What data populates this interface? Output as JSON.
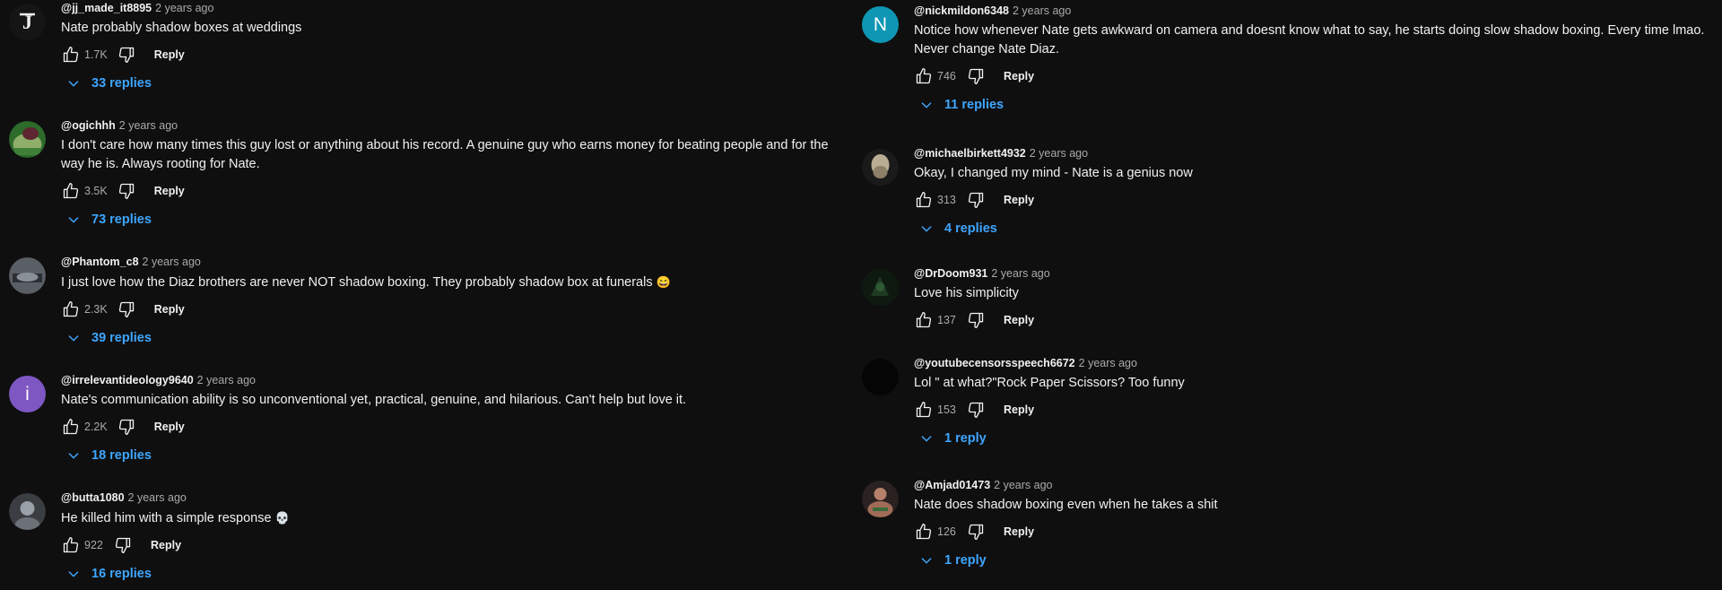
{
  "left": {
    "comments": [
      {
        "author": "@jj_made_it8895",
        "time": "2 years ago",
        "text": "Nate probably shadow boxes at weddings",
        "likes": "1.7K",
        "reply_label": "Reply",
        "replies": "33 replies"
      },
      {
        "author": "@ogichhh",
        "time": "2 years ago",
        "text": "I don't care how many times this guy lost or anything about his record. A genuine guy who earns money for beating people and for the way he is. Always rooting for Nate.",
        "likes": "3.5K",
        "reply_label": "Reply",
        "replies": "73 replies"
      },
      {
        "author": "@Phantom_c8",
        "time": "2 years ago",
        "text": "I just love how the Diaz brothers are never NOT shadow boxing. They probably shadow box at funerals",
        "emoji": "😄",
        "likes": "2.3K",
        "reply_label": "Reply",
        "replies": "39 replies"
      },
      {
        "author": "@irrelevantideology9640",
        "time": "2 years ago",
        "text": "Nate's communication ability is so unconventional yet, practical, genuine, and hilarious. Can't help but love it.",
        "likes": "2.2K",
        "reply_label": "Reply",
        "replies": "18 replies",
        "avatar_letter": "i",
        "avatar_color": "#7e57c2"
      },
      {
        "author": "@butta1080",
        "time": "2 years ago",
        "text": "He killed him with a simple response",
        "emoji": "💀",
        "likes": "922",
        "reply_label": "Reply",
        "replies": "16 replies"
      }
    ]
  },
  "right": {
    "comments": [
      {
        "author": "@nickmildon6348",
        "time": "2 years ago",
        "text": "Notice how whenever Nate gets awkward on camera and doesnt know what to say, he starts doing slow shadow boxing. Every time lmao. Never change Nate Diaz.",
        "likes": "746",
        "reply_label": "Reply",
        "replies": "11 replies",
        "avatar_letter": "N",
        "avatar_color": "#0f96b4"
      },
      {
        "author": "@michaelbirkett4932",
        "time": "2 years ago",
        "text": "Okay, I changed my mind - Nate is a genius now",
        "likes": "313",
        "reply_label": "Reply",
        "replies": "4 replies"
      },
      {
        "author": "@DrDoom931",
        "time": "2 years ago",
        "text": "Love his simplicity",
        "likes": "137",
        "reply_label": "Reply"
      },
      {
        "author": "@youtubecensorsspeech6672",
        "time": "2 years ago",
        "text": "Lol \" at what?\"Rock Paper Scissors? Too funny",
        "likes": "153",
        "reply_label": "Reply",
        "replies": "1 reply"
      },
      {
        "author": "@Amjad01473",
        "time": "2 years ago",
        "text": "Nate does shadow boxing even when he takes a shit",
        "likes": "126",
        "reply_label": "Reply",
        "replies": "1 reply"
      }
    ]
  },
  "colors": {
    "background": "#0f0f0f",
    "link": "#3ea6ff",
    "muted": "#aaaaaa",
    "text": "#f1f1f1"
  },
  "icons": [
    "thumb-up-icon",
    "thumb-down-icon",
    "chevron-down-icon"
  ]
}
